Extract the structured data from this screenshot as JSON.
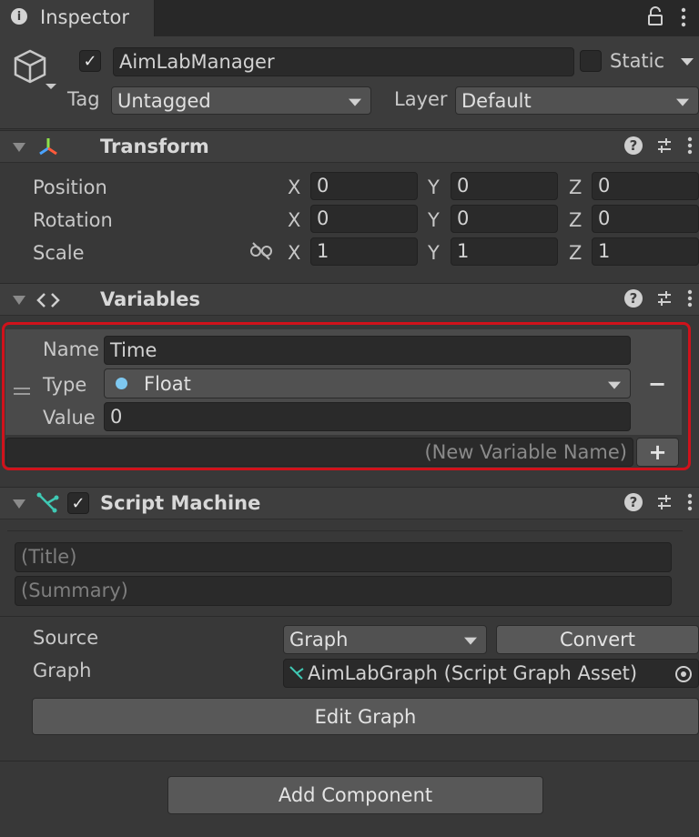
{
  "tab": {
    "title": "Inspector"
  },
  "gameobject": {
    "active": true,
    "name": "AimLabManager",
    "static_label": "Static",
    "tag_label": "Tag",
    "tag_value": "Untagged",
    "layer_label": "Layer",
    "layer_value": "Default"
  },
  "transform": {
    "title": "Transform",
    "rows": [
      {
        "label": "Position",
        "x": "0",
        "y": "0",
        "z": "0"
      },
      {
        "label": "Rotation",
        "x": "0",
        "y": "0",
        "z": "0"
      },
      {
        "label": "Scale",
        "x": "1",
        "y": "1",
        "z": "1"
      }
    ],
    "axis": {
      "x": "X",
      "y": "Y",
      "z": "Z"
    }
  },
  "variables": {
    "title": "Variables",
    "name_label": "Name",
    "name_value": "Time",
    "type_label": "Type",
    "type_value": "Float",
    "value_label": "Value",
    "value_value": "0",
    "remove_label": "−",
    "new_placeholder": "(New Variable Name)",
    "add_label": "+",
    "highlight_color": "#d0121b"
  },
  "script_machine": {
    "title": "Script Machine",
    "enabled": true,
    "title_placeholder": "(Title)",
    "summary_placeholder": "(Summary)",
    "source_label": "Source",
    "source_value": "Graph",
    "convert_label": "Convert",
    "graph_label": "Graph",
    "graph_value": "AimLabGraph (Script Graph Asset)",
    "edit_graph_label": "Edit Graph"
  },
  "add_component_label": "Add Component",
  "colors": {
    "background": "#383838",
    "float_dot": "#7ec8f0"
  }
}
